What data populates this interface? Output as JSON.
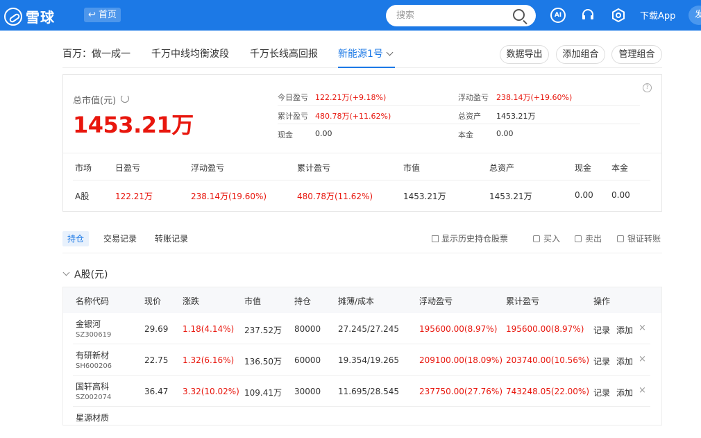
{
  "topbar": {
    "logo_text": "雪球",
    "home_label": "首页",
    "search_placeholder": "搜索",
    "ai_label": "AI",
    "download_label": "下载App",
    "avatar_text": "发"
  },
  "portfolio_tabs": [
    {
      "label": "百万：做一成一"
    },
    {
      "label": "千万中线均衡波段"
    },
    {
      "label": "千万长线高回报"
    },
    {
      "label": "新能源1号"
    }
  ],
  "toolbar": {
    "export_label": "数据导出",
    "add_label": "添加组合",
    "manage_label": "管理组合"
  },
  "summary": {
    "total_label": "总市值(元)",
    "total_value": "1453.21万",
    "today_pl_label": "今日盈亏",
    "today_pl_value": "122.21万(+9.18%)",
    "float_pl_label": "浮动盈亏",
    "float_pl_value": "238.14万(+19.60%)",
    "cum_pl_label": "累计盈亏",
    "cum_pl_value": "480.78万(+11.62%)",
    "total_assets_label": "总资产",
    "total_assets_value": "1453.21万",
    "cash_label": "现金",
    "cash_value": "0.00",
    "principal_label": "本金",
    "principal_value": "0.00",
    "help_symbol": "?"
  },
  "market_table": {
    "headers": [
      "市场",
      "日盈亏",
      "浮动盈亏",
      "累计盈亏",
      "市值",
      "总资产",
      "现金",
      "本金"
    ],
    "row": [
      "A股",
      "122.21万",
      "238.14万(19.60%)",
      "480.78万(11.62%)",
      "1453.21万",
      "1453.21万",
      "0.00",
      "0.00"
    ]
  },
  "sub_tabs": {
    "holdings": "持仓",
    "trades": "交易记录",
    "transfers": "转账记录",
    "history_label": "显示历史持仓股票",
    "buy_label": "买入",
    "sell_label": "卖出",
    "bank_label": "银证转账"
  },
  "section": {
    "title": "A股(元)"
  },
  "holdings_table": {
    "headers": [
      "名称代码",
      "现价",
      "涨跌",
      "市值",
      "持仓",
      "摊薄/成本",
      "浮动盈亏",
      "累计盈亏",
      "操作"
    ],
    "record_label": "记录",
    "add_label": "添加",
    "delete_symbol": "×",
    "rows": [
      {
        "name": "金银河",
        "code": "SZ300619",
        "price": "29.69",
        "change": "1.18(4.14%)",
        "mkt_value": "237.52万",
        "position": "80000",
        "cost": "27.245/27.245",
        "float_pl": "195600.00(8.97%)",
        "cum_pl": "195600.00(8.97%)"
      },
      {
        "name": "有研新材",
        "code": "SH600206",
        "price": "22.75",
        "change": "1.32(6.16%)",
        "mkt_value": "136.50万",
        "position": "60000",
        "cost": "19.354/19.265",
        "float_pl": "209100.00(18.09%)",
        "cum_pl": "203740.00(10.56%)"
      },
      {
        "name": "国轩高科",
        "code": "SZ002074",
        "price": "36.47",
        "change": "3.32(10.02%)",
        "mkt_value": "109.41万",
        "position": "30000",
        "cost": "11.695/28.545",
        "float_pl": "237750.00(27.76%)",
        "cum_pl": "743248.05(22.00%)"
      },
      {
        "name": "星源材质",
        "code": "",
        "price": "",
        "change": "",
        "mkt_value": "",
        "position": "",
        "cost": "",
        "float_pl": "",
        "cum_pl": ""
      }
    ]
  }
}
